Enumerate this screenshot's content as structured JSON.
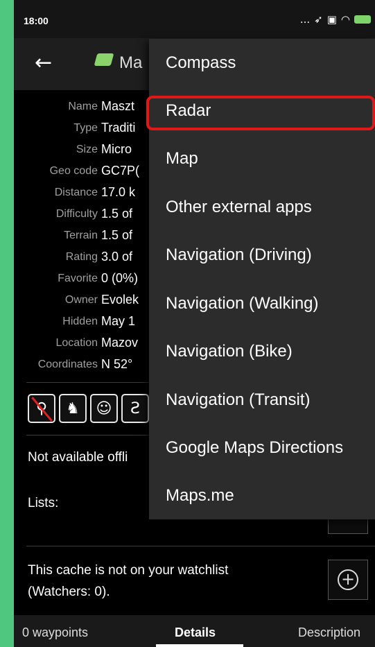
{
  "status_bar": {
    "time": "18:00",
    "signal_text": "...",
    "icons": [
      "location-icon",
      "sim-icon",
      "wifi-icon",
      "battery-icon"
    ]
  },
  "app_bar": {
    "back_icon": "back-arrow-icon",
    "title": "Ma"
  },
  "details": [
    {
      "label": "Name",
      "value": "Maszt"
    },
    {
      "label": "Type",
      "value": "Traditi"
    },
    {
      "label": "Size",
      "value": "Micro"
    },
    {
      "label": "Geo code",
      "value": "GC7P("
    },
    {
      "label": "Distance",
      "value": "17.0 k"
    },
    {
      "label": "Difficulty",
      "value": "1.5 of"
    },
    {
      "label": "Terrain",
      "value": "1.5 of"
    },
    {
      "label": "Rating",
      "value": "3.0 of"
    },
    {
      "label": "Favorite",
      "value": "0 (0%)"
    },
    {
      "label": "Owner",
      "value": "Evolek"
    },
    {
      "label": "Hidden",
      "value": "May 1"
    },
    {
      "label": "Location",
      "value": "Mazov"
    },
    {
      "label": "Coordinates",
      "value": "N 52°"
    }
  ],
  "attributes": [
    {
      "icon": "no-binoculars-icon",
      "glyph": "⚲"
    },
    {
      "icon": "dog-icon",
      "glyph": "♞"
    },
    {
      "icon": "kid-friendly-icon",
      "glyph": "☺"
    },
    {
      "icon": "hiking-icon",
      "glyph": "Ƨ"
    }
  ],
  "offline_text": "Not available offli",
  "lists_label": "Lists:",
  "watchlist": {
    "line1": "This cache is not on your watchlist",
    "line2": "(Watchers: 0).",
    "button_icon": "plus-circle-icon"
  },
  "tabs": {
    "waypoints": "0 waypoints",
    "details": "Details",
    "description": "Description"
  },
  "menu": {
    "items": [
      "Compass",
      "Radar",
      "Map",
      "Other external apps",
      "Navigation (Driving)",
      "Navigation (Walking)",
      "Navigation (Bike)",
      "Navigation (Transit)",
      "Google Maps Directions",
      "Maps.me"
    ],
    "highlighted_item": "Radar"
  },
  "colors": {
    "background_frame": "#4fc77f",
    "highlight": "#e01818",
    "menu_bg": "#2c2c2c",
    "battery": "#7ed36a"
  }
}
